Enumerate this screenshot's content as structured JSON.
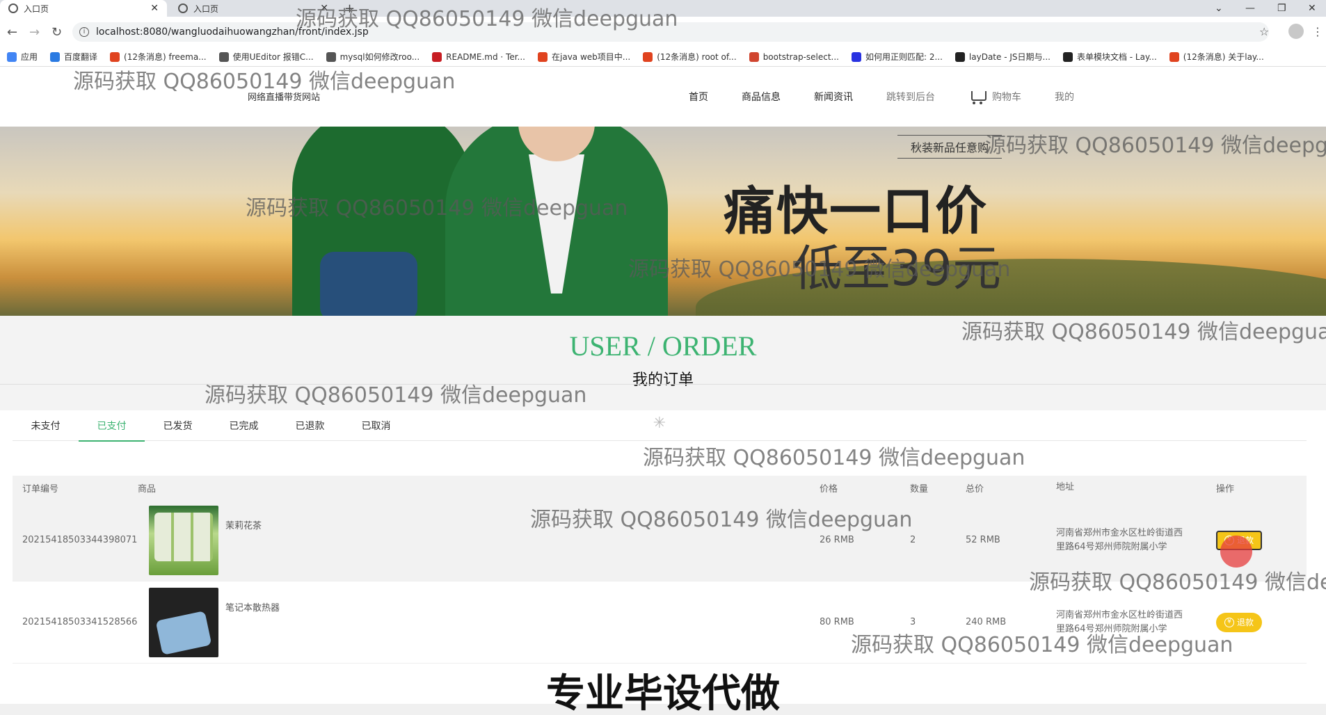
{
  "browser": {
    "tabs": [
      {
        "title": "入口页"
      },
      {
        "title": "入口页"
      }
    ],
    "url": "localhost:8080/wangluodaihuowangzhan/front/index.jsp",
    "bookmarks": [
      {
        "label": "应用",
        "color": "#4285f4"
      },
      {
        "label": "百度翻译",
        "color": "#2a7ae2"
      },
      {
        "label": "(12条消息) freema...",
        "color": "#e0431f"
      },
      {
        "label": "使用UEditor 报错C...",
        "color": "#555555"
      },
      {
        "label": "mysql如何修改roo...",
        "color": "#555555"
      },
      {
        "label": "README.md · Ter...",
        "color": "#c71d23"
      },
      {
        "label": "在java web项目中...",
        "color": "#e0431f"
      },
      {
        "label": "(12条消息) root of...",
        "color": "#e0431f"
      },
      {
        "label": "bootstrap-select...",
        "color": "#d0452f"
      },
      {
        "label": "如何用正则匹配: 2...",
        "color": "#2932e1"
      },
      {
        "label": "layDate - JS日期与...",
        "color": "#222222"
      },
      {
        "label": "表单模块文档 - Lay...",
        "color": "#222222"
      },
      {
        "label": "(12条消息) 关于lay...",
        "color": "#e0431f"
      }
    ]
  },
  "site": {
    "name": "网络直播带货网站",
    "nav": [
      "首页",
      "商品信息",
      "新闻资讯",
      "跳转到后台",
      "购物车",
      "我的"
    ]
  },
  "banner": {
    "tag": "秋装新品任意购",
    "headline": "痛快一口价",
    "subline": "低至39元"
  },
  "section": {
    "title_en": "USER / ORDER",
    "title_cn": "我的订单"
  },
  "order_tabs": [
    {
      "label": "未支付",
      "active": false
    },
    {
      "label": "已支付",
      "active": true
    },
    {
      "label": "已发货",
      "active": false
    },
    {
      "label": "已完成",
      "active": false
    },
    {
      "label": "已退款",
      "active": false
    },
    {
      "label": "已取消",
      "active": false
    }
  ],
  "table": {
    "headers": {
      "id": "订单编号",
      "goods": "商品",
      "price": "价格",
      "qty": "数量",
      "total": "总价",
      "addr": "地址",
      "op": "操作"
    },
    "rows": [
      {
        "id": "20215418503344398071",
        "goods": "茉莉花茶",
        "price": "26 RMB",
        "qty": "2",
        "total": "52 RMB",
        "addr_line1": "河南省郑州市金水区杜岭街道西",
        "addr_line2": "里路64号郑州师院附属小学",
        "op": "退款"
      },
      {
        "id": "20215418503341528566",
        "goods": "笔记本散热器",
        "price": "80 RMB",
        "qty": "3",
        "total": "240 RMB",
        "addr_line1": "河南省郑州市金水区杜岭街道西",
        "addr_line2": "里路64号郑州师院附属小学",
        "op": "退款"
      }
    ]
  },
  "overlay": {
    "promo": "专业毕设代做",
    "watermark": "源码获取 QQ86050149 微信deepguan"
  },
  "colors": {
    "accent": "#3cb371",
    "refund_button": "#f5c518"
  }
}
